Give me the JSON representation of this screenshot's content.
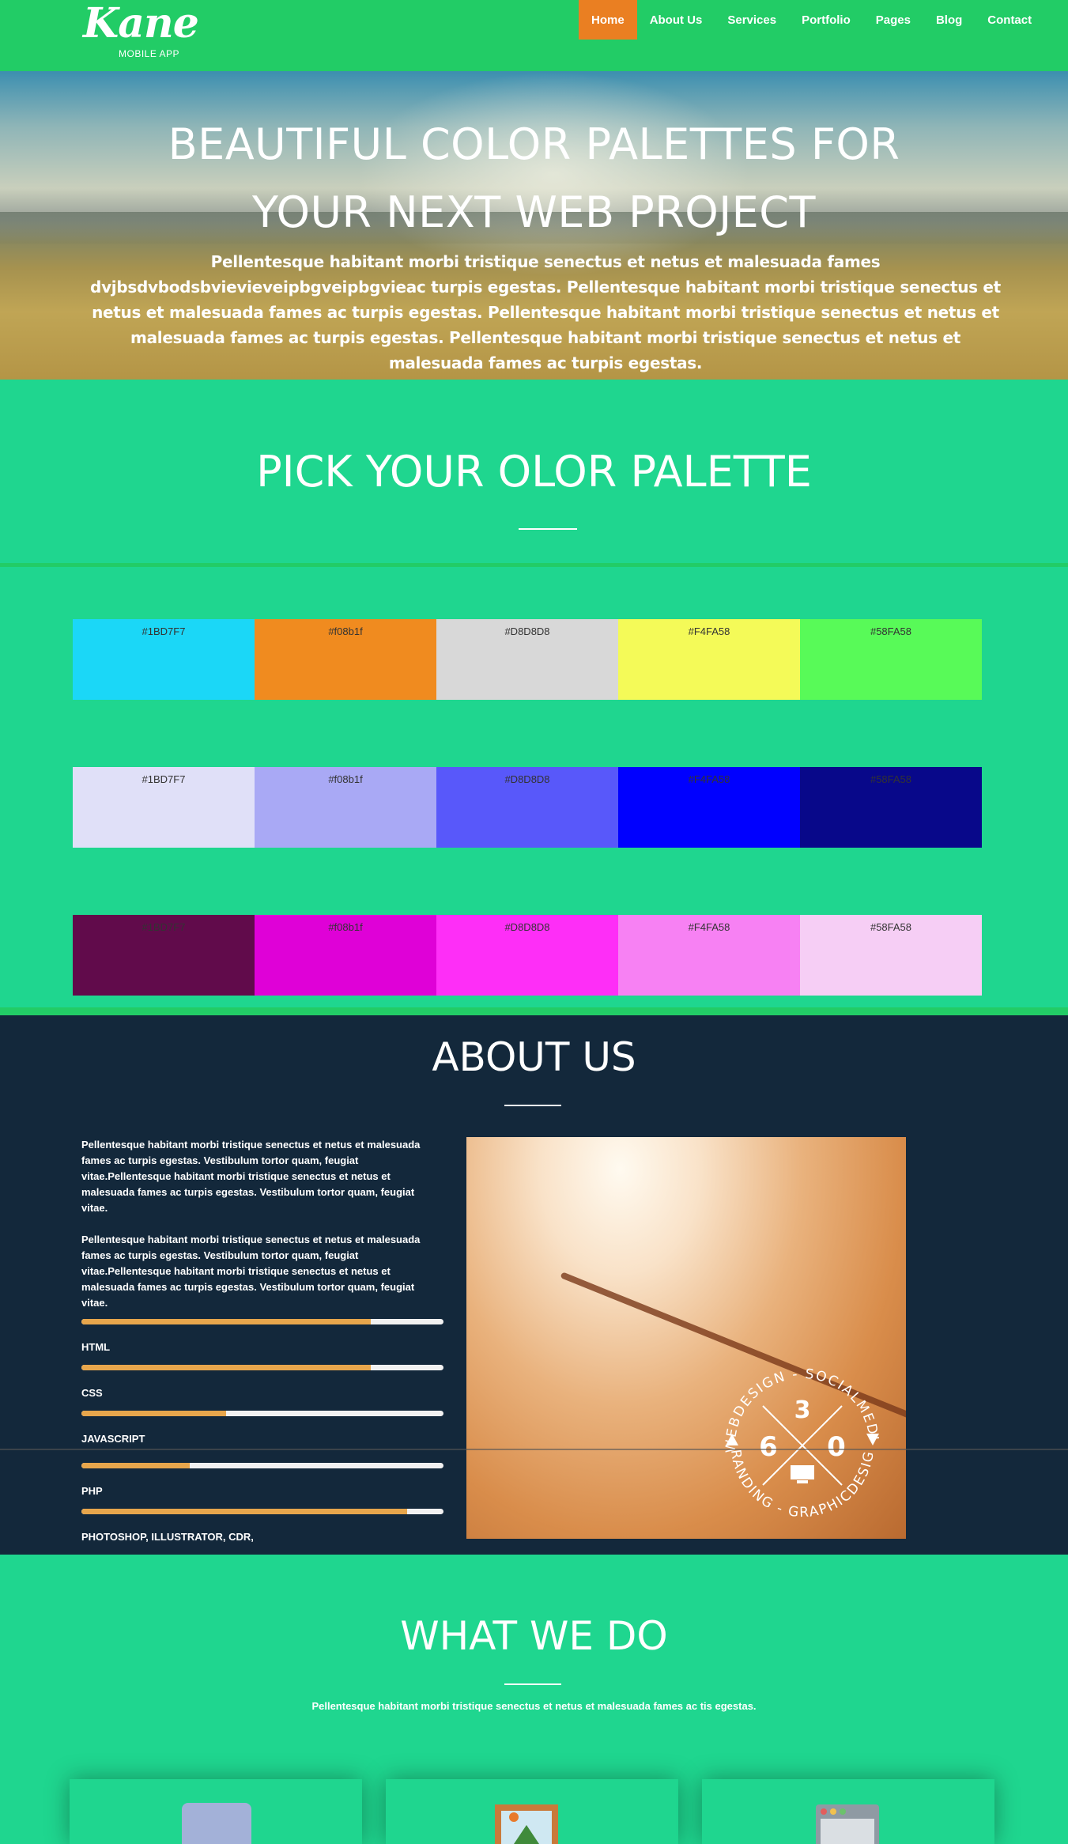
{
  "brand": {
    "name": "Kane",
    "tagline": "MOBILE APP"
  },
  "nav": {
    "items": [
      {
        "label": "Home",
        "active": true
      },
      {
        "label": "About Us"
      },
      {
        "label": "Services"
      },
      {
        "label": "Portfolio"
      },
      {
        "label": "Pages"
      },
      {
        "label": "Blog"
      },
      {
        "label": "Contact"
      }
    ],
    "active_color": "#ea7f22",
    "bar_color": "#22cc66"
  },
  "hero": {
    "title_line1": "BEAUTIFUL COLOR PALETTES FOR",
    "title_line2": "YOUR NEXT WEB PROJECT",
    "text": "Pellentesque habitant morbi tristique senectus et netus et malesuada fames dvjbsdvbodsbvievieveipbgveipbgvieac turpis egestas. Pellentesque habitant morbi tristique senectus et netus et malesuada fames ac turpis egestas. Pellentesque habitant morbi tristique senectus et netus et malesuada fames ac turpis egestas. Pellentesque habitant morbi tristique senectus et netus et malesuada fames ac turpis egestas."
  },
  "palette": {
    "title": "PICK YOUR OLOR PALETTE",
    "rows": [
      [
        {
          "label": "#1BD7F7",
          "color": "#1bd7f7"
        },
        {
          "label": "#f08b1f",
          "color": "#f08b1f"
        },
        {
          "label": "#D8D8D8",
          "color": "#d8d8d8"
        },
        {
          "label": "#F4FA58",
          "color": "#f4fa58"
        },
        {
          "label": "#58FA58",
          "color": "#58fa58"
        }
      ],
      [
        {
          "label": "#1BD7F7",
          "color": "#e0e0f8"
        },
        {
          "label": "#f08b1f",
          "color": "#a9a9f5"
        },
        {
          "label": "#D8D8D8",
          "color": "#5858fa"
        },
        {
          "label": "#F4FA58",
          "color": "#0000ff"
        },
        {
          "label": "#58FA58",
          "color": "#08088a"
        }
      ],
      [
        {
          "label": "#1BD7F7",
          "color": "#610b4b"
        },
        {
          "label": "#f08b1f",
          "color": "#df01d7"
        },
        {
          "label": "#D8D8D8",
          "color": "#fe2ef7"
        },
        {
          "label": "#F4FA58",
          "color": "#f781f3"
        },
        {
          "label": "#58FA58",
          "color": "#f6cef5"
        }
      ]
    ]
  },
  "about": {
    "title": "ABOUT US",
    "para1": "Pellentesque habitant morbi tristique senectus et netus et malesuada fames ac turpis egestas. Vestibulum tortor quam, feugiat vitae.Pellentesque habitant morbi tristique senectus et netus et malesuada fames ac turpis egestas. Vestibulum tortor quam, feugiat vitae.",
    "para2": "Pellentesque habitant morbi tristique senectus et netus et malesuada fames ac turpis egestas. Vestibulum tortor quam, feugiat vitae.Pellentesque habitant morbi tristique senectus et netus et malesuada fames ac turpis egestas. Vestibulum tortor quam, feugiat vitae.",
    "skills": [
      {
        "label": "HTML",
        "level": 0.8
      },
      {
        "label": "CSS",
        "level": 0.8
      },
      {
        "label": "JAVASCRIPT",
        "level": 0.4
      },
      {
        "label": "PHP",
        "level": 0.3
      },
      {
        "label": "PHOTOSHOP, ILLUSTRATOR, CDR,",
        "level": 0.9
      }
    ],
    "badge": {
      "top_arc": "WEBDESIGN - SOCIALMEDIA",
      "bottom_arc": "BRANDING - GRAPHICDESIGN",
      "num_top": "3",
      "num_left": "6",
      "num_right": "0"
    },
    "bar_color": "#e7a64c"
  },
  "services": {
    "title": "WHAT WE DO",
    "text": "Pellentesque habitant morbi tristique senectus et netus et malesuada fames ac tis egestas."
  }
}
